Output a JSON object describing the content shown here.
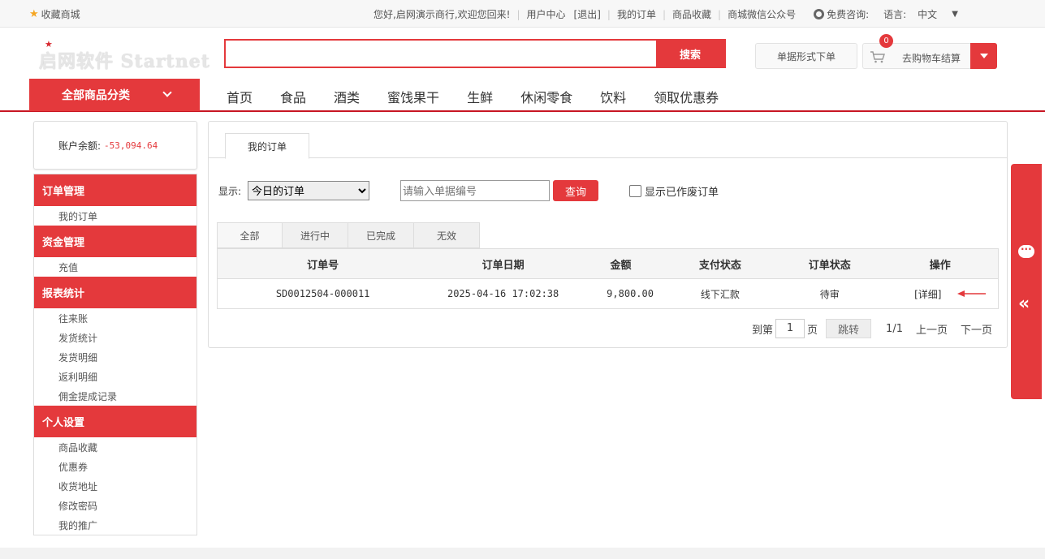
{
  "topbar": {
    "favorite": "收藏商城",
    "welcome": "您好,启网演示商行,欢迎您回来!",
    "user_center": "用户中心",
    "logout": "[退出]",
    "my_orders": "我的订单",
    "favorites": "商品收藏",
    "wechat": "商城微信公众号",
    "free_consult": "免费咨询:",
    "language_label": "语言:",
    "language_value": "中文"
  },
  "header": {
    "logo_text": "启网软件 Startnet",
    "search_button": "搜索",
    "bill_order_button": "单据形式下单",
    "cart_label": "去购物车结算",
    "cart_count": "0"
  },
  "nav": {
    "all_categories": "全部商品分类",
    "items": [
      "首页",
      "食品",
      "酒类",
      "蜜饯果干",
      "生鲜",
      "休闲零食",
      "饮料",
      "领取优惠券"
    ]
  },
  "sidebar": {
    "balance_label": "账户余额:",
    "balance_value": "-53,094.64",
    "groups": [
      {
        "title": "订单管理",
        "items": [
          "我的订单"
        ]
      },
      {
        "title": "资金管理",
        "items": [
          "充值"
        ]
      },
      {
        "title": "报表统计",
        "items": [
          "往来账",
          "发货统计",
          "发货明细",
          "返利明细",
          "佣金提成记录"
        ]
      },
      {
        "title": "个人设置",
        "items": [
          "商品收藏",
          "优惠券",
          "收货地址",
          "修改密码",
          "我的推广"
        ]
      }
    ]
  },
  "main": {
    "tab_title": "我的订单",
    "show_label": "显示:",
    "show_selected": "今日的订单",
    "search_placeholder": "请输入单据编号",
    "query_button": "查询",
    "show_voided": "显示已作废订单",
    "status_tabs": [
      "全部",
      "进行中",
      "已完成",
      "无效"
    ],
    "columns": [
      "订单号",
      "订单日期",
      "金额",
      "支付状态",
      "订单状态",
      "操作"
    ],
    "rows": [
      {
        "order_no": "SD0012504-000011",
        "date": "2025-04-16 17:02:38",
        "amount": "9,800.00",
        "pay_status": "线下汇款",
        "order_status": "待审",
        "action": "[详细]"
      }
    ],
    "pager": {
      "goto_label": "到第",
      "page_value": "1",
      "page_unit": "页",
      "jump_button": "跳转",
      "page_info": "1/1",
      "prev": "上一页",
      "next": "下一页"
    }
  },
  "colors": {
    "accent": "#e4393c",
    "nav_underline": "#c81623"
  }
}
